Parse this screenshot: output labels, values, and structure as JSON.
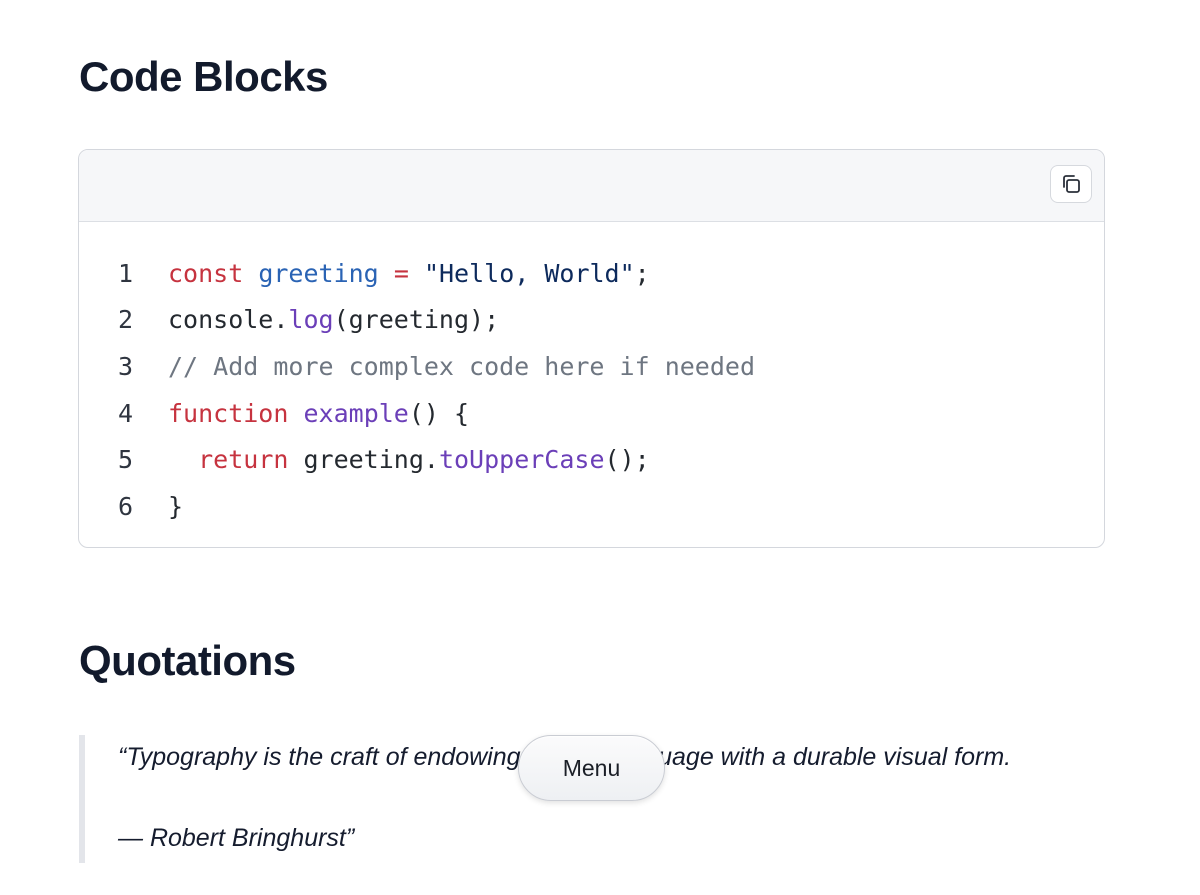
{
  "sections": {
    "code_title": "Code Blocks",
    "quotes_title": "Quotations"
  },
  "code_block": {
    "copy_icon": "copy-icon",
    "lines": [
      {
        "number": "1",
        "tokens": [
          {
            "t": "const",
            "c": "kw"
          },
          {
            "t": " ",
            "c": "plain"
          },
          {
            "t": "greeting",
            "c": "var"
          },
          {
            "t": " ",
            "c": "plain"
          },
          {
            "t": "=",
            "c": "op"
          },
          {
            "t": " ",
            "c": "plain"
          },
          {
            "t": "\"Hello, World\"",
            "c": "str"
          },
          {
            "t": ";",
            "c": "plain"
          }
        ]
      },
      {
        "number": "2",
        "tokens": [
          {
            "t": "console.",
            "c": "plain"
          },
          {
            "t": "log",
            "c": "fn"
          },
          {
            "t": "(greeting);",
            "c": "plain"
          }
        ]
      },
      {
        "number": "3",
        "tokens": [
          {
            "t": "// Add more complex code here if needed",
            "c": "cm"
          }
        ]
      },
      {
        "number": "4",
        "tokens": [
          {
            "t": "function",
            "c": "kw"
          },
          {
            "t": " ",
            "c": "plain"
          },
          {
            "t": "example",
            "c": "fn"
          },
          {
            "t": "() {",
            "c": "plain"
          }
        ]
      },
      {
        "number": "5",
        "tokens": [
          {
            "t": "  ",
            "c": "plain"
          },
          {
            "t": "return",
            "c": "kw"
          },
          {
            "t": " greeting.",
            "c": "plain"
          },
          {
            "t": "toUpperCase",
            "c": "fn"
          },
          {
            "t": "();",
            "c": "plain"
          }
        ]
      },
      {
        "number": "6",
        "tokens": [
          {
            "t": "}",
            "c": "plain"
          }
        ]
      }
    ]
  },
  "quote": {
    "text": "“Typography is the craft of endowing human language with a durable visual form.",
    "author": "— Robert Bringhurst”"
  },
  "menu": {
    "label": "Menu"
  },
  "colors": {
    "keyword": "#c6333f",
    "variable": "#2a63b4",
    "string": "#0d2a5c",
    "function": "#6b3fb8",
    "comment": "#6e7681"
  }
}
